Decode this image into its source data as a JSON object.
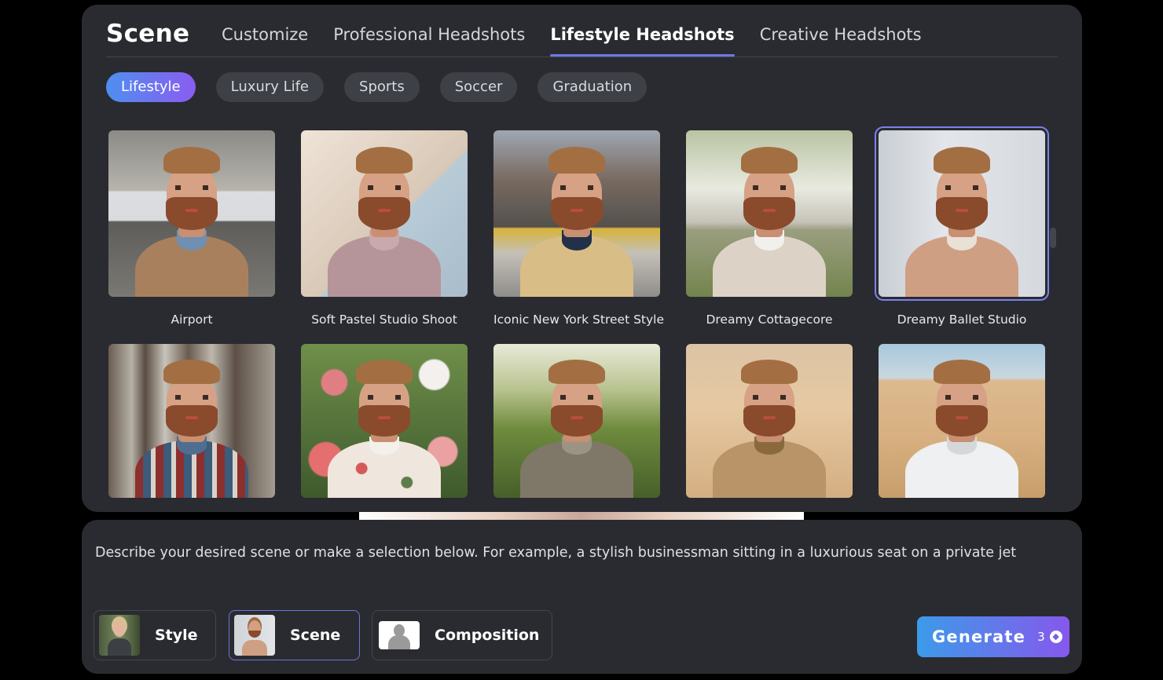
{
  "scene_panel": {
    "title": "Scene",
    "tabs": [
      {
        "label": "Customize",
        "active": false
      },
      {
        "label": "Professional Headshots",
        "active": false
      },
      {
        "label": "Lifestyle Headshots",
        "active": true
      },
      {
        "label": "Creative Headshots",
        "active": false
      }
    ],
    "chips": [
      {
        "label": "Lifestyle",
        "active": true
      },
      {
        "label": "Luxury Life",
        "active": false
      },
      {
        "label": "Sports",
        "active": false
      },
      {
        "label": "Soccer",
        "active": false
      },
      {
        "label": "Graduation",
        "active": false
      }
    ],
    "scenes": [
      {
        "label": "Airport",
        "selected": false
      },
      {
        "label": "Soft Pastel Studio Shoot",
        "selected": false
      },
      {
        "label": "Iconic New York Street Style",
        "selected": false
      },
      {
        "label": "Dreamy Cottagecore",
        "selected": false
      },
      {
        "label": "Dreamy Ballet Studio",
        "selected": true
      }
    ]
  },
  "bottom_panel": {
    "prompt_placeholder": "Describe your desired scene or make a selection below. For example, a stylish businessman sitting in a luxurious seat on a private jet",
    "options": [
      {
        "label": "Style",
        "selected": false
      },
      {
        "label": "Scene",
        "selected": true
      },
      {
        "label": "Composition",
        "selected": false
      }
    ],
    "generate": {
      "label": "Generate",
      "credits": "3"
    }
  },
  "colors": {
    "accent": "#6f76e6",
    "panel_bg": "#2a2b30",
    "generate_gradient_start": "#3c9bea",
    "generate_gradient_end": "#8658ec"
  }
}
